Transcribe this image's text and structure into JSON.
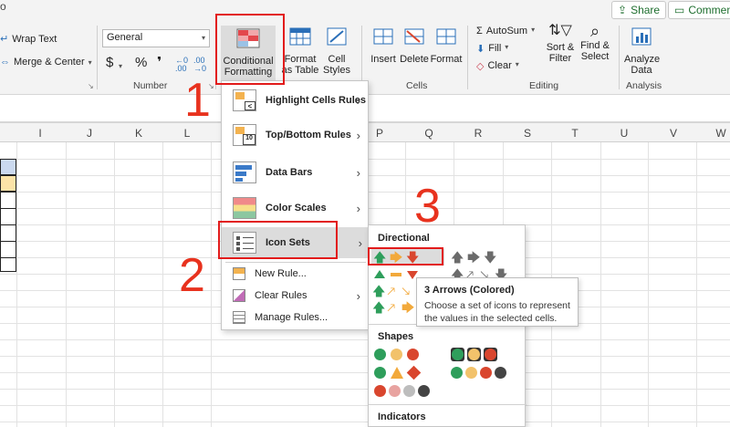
{
  "topbar": {
    "share": "Share",
    "comments": "Commen"
  },
  "ribbon": {
    "alignment": {
      "wrap_text": "Wrap Text",
      "merge_center": "Merge & Center"
    },
    "number": {
      "format_value": "General",
      "currency": "$",
      "percent": "%",
      "comma": "❜",
      "group_label": "Number"
    },
    "styles": {
      "conditional_formatting": "Conditional Formatting",
      "format_as_table": "Format as Table",
      "cell_styles": "Cell Styles"
    },
    "cells": {
      "insert": "Insert",
      "delete": "Delete",
      "format": "Format",
      "group_label": "Cells"
    },
    "editing": {
      "autosum": "AutoSum",
      "fill": "Fill",
      "clear": "Clear",
      "sort_filter": "Sort & Filter",
      "find_select": "Find & Select",
      "group_label": "Editing"
    },
    "analysis": {
      "analyze_data": "Analyze Data",
      "group_label": "Analysis"
    }
  },
  "columns": [
    "I",
    "J",
    "K",
    "L",
    "P",
    "Q",
    "R",
    "S",
    "T",
    "U",
    "V",
    "W"
  ],
  "cf_menu": {
    "items": [
      "Highlight Cells Rules",
      "Top/Bottom Rules",
      "Data Bars",
      "Color Scales",
      "Icon Sets"
    ],
    "small_items": [
      "New Rule...",
      "Clear Rules",
      "Manage Rules..."
    ]
  },
  "icon_sets_panel": {
    "directional": "Directional",
    "shapes": "Shapes",
    "indicators": "Indicators"
  },
  "tooltip": {
    "title": "3 Arrows (Colored)",
    "body_line1": "Choose a set of icons to represent",
    "body_line2": "the values in the selected cells."
  },
  "annotations": {
    "one": "1",
    "two": "2",
    "three": "3"
  },
  "colors": {
    "accent_red": "#e21b1b",
    "annotation": "#e8321e",
    "green": "#2e9e5b",
    "yellow": "#f2a93b",
    "red": "#d9462e",
    "gray": "#6b6b6b"
  }
}
